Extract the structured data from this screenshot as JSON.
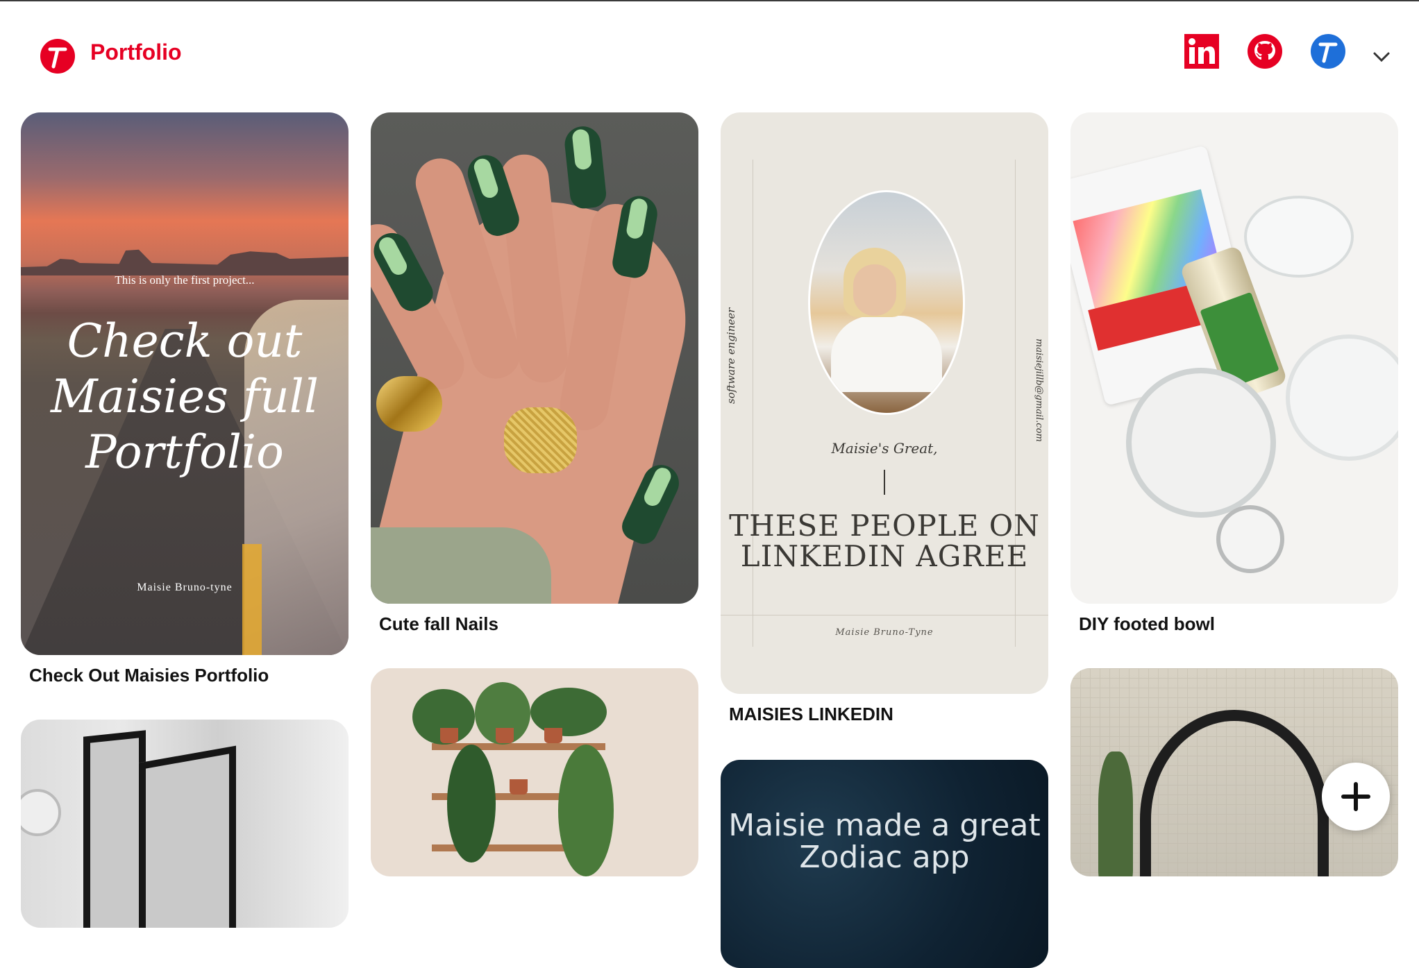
{
  "header": {
    "brand": "Portfolio",
    "brand_color": "#e60023",
    "icons": [
      "linkedin-icon",
      "github-icon",
      "avatar-icon",
      "chevron-down-icon"
    ]
  },
  "pins": [
    {
      "title": "Check Out Maisies Portfolio",
      "overlay_sub": "This is only the first project...",
      "overlay_big": "Check out Maisies full Portfolio",
      "overlay_sign": "Maisie Bruno-tyne"
    },
    {
      "title": "Cute fall Nails"
    },
    {
      "title": "MAISIES LINKEDIN",
      "card_great": "Maisie's Great,",
      "card_big": "THESE PEOPLE ON LINKEDIN AGREE",
      "card_sign": "Maisie Bruno-Tyne",
      "card_side_left": "software engineer",
      "card_side_right": "maisiejillb@gmail.com"
    },
    {
      "title": "DIY footed bowl"
    },
    {
      "title": ""
    },
    {
      "title": ""
    },
    {
      "title": "",
      "overlay_text": "Maisie made a great Zodiac app"
    },
    {
      "title": ""
    }
  ],
  "fab": {
    "icon": "plus-icon"
  }
}
